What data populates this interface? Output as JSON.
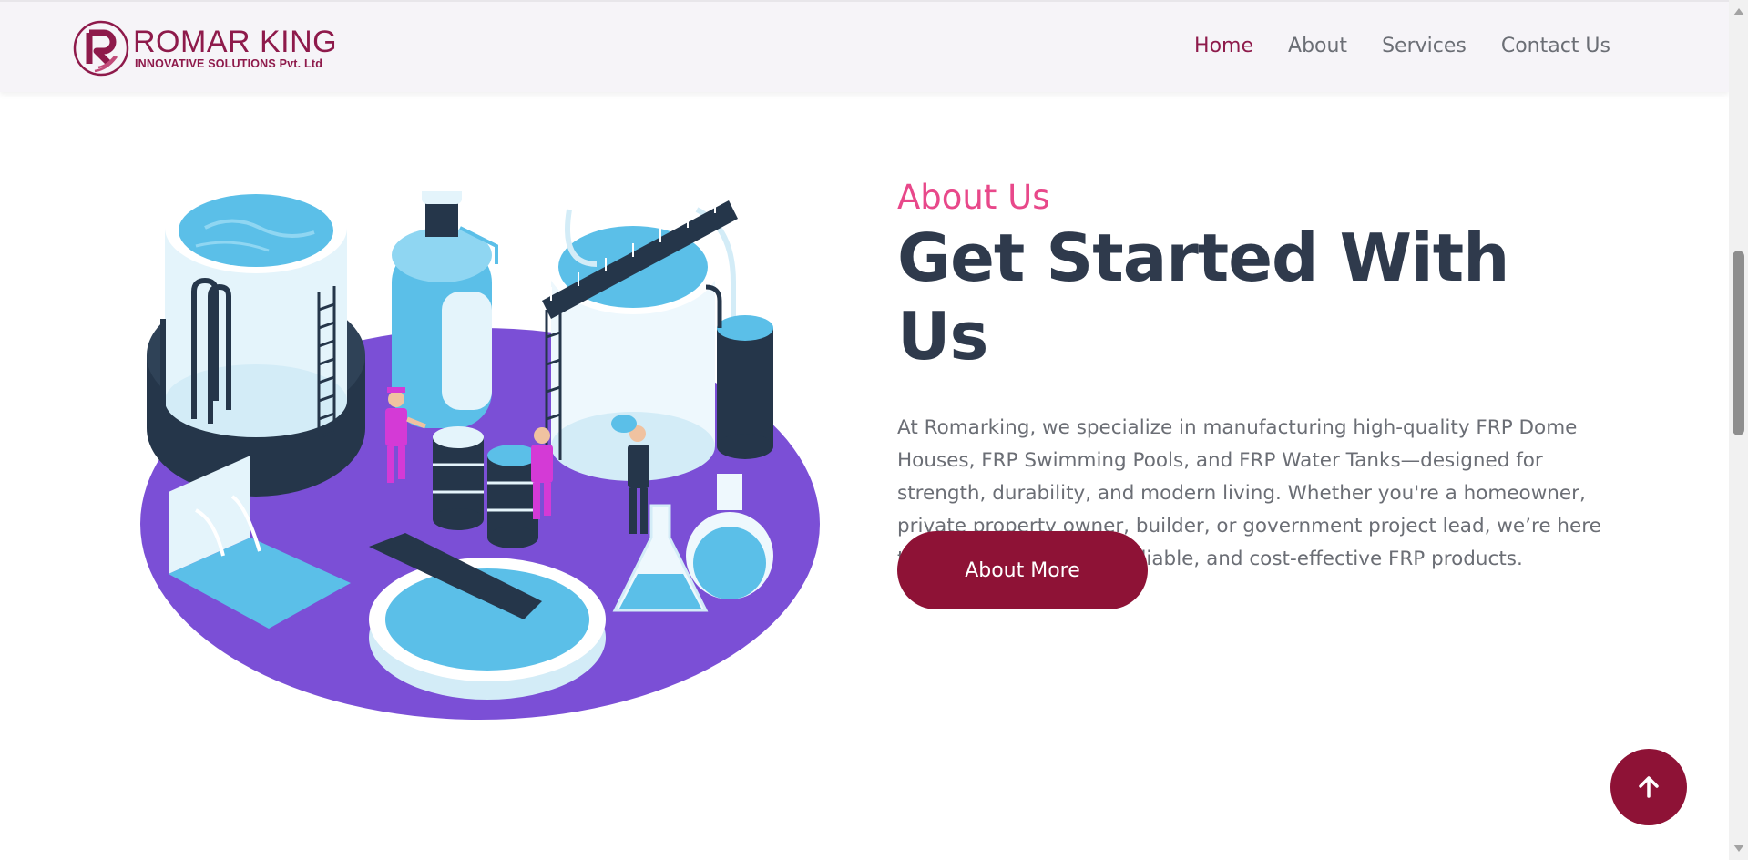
{
  "brand": {
    "name": "ROMAR KING",
    "tagline": "INNOVATIVE SOLUTIONS Pvt. Ltd",
    "logo_icon": "r-monogram-logo-icon",
    "color": "#8e1a4b"
  },
  "nav": {
    "items": [
      {
        "label": "Home",
        "active": true
      },
      {
        "label": "About",
        "active": false
      },
      {
        "label": "Services",
        "active": false
      },
      {
        "label": "Contact Us",
        "active": false
      }
    ]
  },
  "about": {
    "eyebrow": "About Us",
    "heading": "Get Started With Us",
    "body": "At Romarking, we specialize in manufacturing high-quality FRP Dome Houses, FRP Swimming Pools, and FRP Water Tanks—designed for strength, durability, and modern living. Whether you're a homeowner, private property owner, builder, or government project lead, we’re here to deliver customized, reliable, and cost-effective FRP products.",
    "button_label": "About More",
    "illustration_icon": "water-treatment-plant-illustration"
  },
  "back_to_top": {
    "icon": "arrow-up-icon"
  },
  "colors": {
    "accent": "#8e1236",
    "eyebrow": "#e8488a",
    "heading": "#2f3a4c",
    "body": "#6b6e75",
    "platform": "#7b4fd6",
    "water": "#5bbfe8",
    "dark": "#25364a"
  }
}
